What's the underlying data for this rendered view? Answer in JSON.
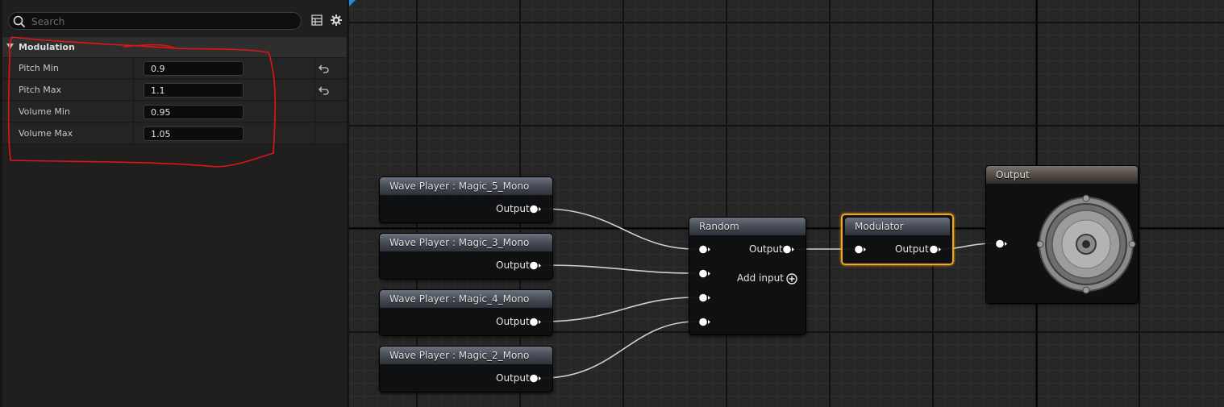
{
  "details": {
    "search": {
      "placeholder": "Search",
      "value": ""
    },
    "category": {
      "label": "Modulation"
    },
    "properties": [
      {
        "name": "Pitch Min",
        "value": "0.9",
        "resettable": true
      },
      {
        "name": "Pitch Max",
        "value": "1.1",
        "resettable": true
      },
      {
        "name": "Volume Min",
        "value": "0.95",
        "resettable": false
      },
      {
        "name": "Volume Max",
        "value": "1.05",
        "resettable": false
      }
    ],
    "annotation_color": "#e01515"
  },
  "graph": {
    "wave_players": [
      {
        "title": "Wave Player : Magic_5_Mono",
        "output_label": "Output"
      },
      {
        "title": "Wave Player : Magic_3_Mono",
        "output_label": "Output"
      },
      {
        "title": "Wave Player : Magic_4_Mono",
        "output_label": "Output"
      },
      {
        "title": "Wave Player : Magic_2_Mono",
        "output_label": "Output"
      }
    ],
    "random": {
      "title": "Random",
      "output_label": "Output",
      "add_input_label": "Add input"
    },
    "modulator": {
      "title": "Modulator",
      "output_label": "Output",
      "selected_color": "#f4a51c"
    },
    "output": {
      "title": "Output",
      "icon": "speaker-icon"
    },
    "colors": {
      "accent": "#1e8fe0",
      "wire": "#cfcfcf"
    }
  }
}
